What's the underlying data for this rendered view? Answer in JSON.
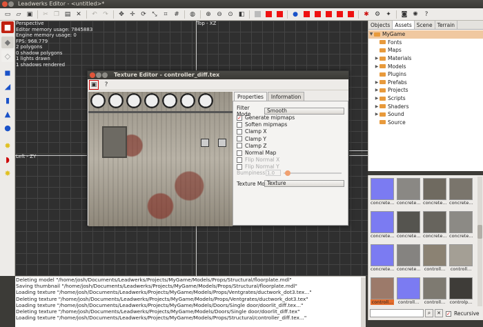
{
  "window": {
    "title": "Leadwerks Editor - <untitled>*"
  },
  "dialog": {
    "title": "Texture Editor - controller_diff.tex",
    "tabs": [
      "Properties",
      "Information"
    ],
    "filter_mode_label": "Filter Mode",
    "filter_mode_value": "Smooth",
    "options": [
      {
        "label": "Generate mipmaps",
        "checked": true,
        "enabled": true
      },
      {
        "label": "Soften mipmaps",
        "checked": false,
        "enabled": true
      },
      {
        "label": "Clamp X",
        "checked": false,
        "enabled": true
      },
      {
        "label": "Clamp Y",
        "checked": false,
        "enabled": true
      },
      {
        "label": "Clamp Z",
        "checked": false,
        "enabled": true
      },
      {
        "label": "Normal Map",
        "checked": false,
        "enabled": true
      },
      {
        "label": "Flip Normal X",
        "checked": false,
        "enabled": false
      },
      {
        "label": "Flip Normal Y",
        "checked": false,
        "enabled": false
      }
    ],
    "bumpiness_label": "Bumpiness",
    "bumpiness_value": "1.0",
    "texture_mode_label": "Texture Mo",
    "texture_mode_value": "Texture"
  },
  "viewports": {
    "perspective": {
      "lines": [
        "Perspective",
        "Editor memory usage: 7845883",
        "Engine memory usage: 0",
        "FPS: 968.779",
        "2 polygons",
        "0 shadow polygons",
        "1 lights drawn",
        "1 shadows rendered"
      ]
    },
    "top": {
      "label": "Top - XZ"
    },
    "left": {
      "label": "Left - ZY"
    }
  },
  "right_panel": {
    "tabs": [
      "Objects",
      "Assets",
      "Scene",
      "Terrain"
    ],
    "active_tab": "Assets",
    "tree": [
      {
        "label": "MyGame",
        "level": 0,
        "arrow": "▼"
      },
      {
        "label": "Fonts",
        "level": 1,
        "arrow": ""
      },
      {
        "label": "Maps",
        "level": 1,
        "arrow": ""
      },
      {
        "label": "Materials",
        "level": 1,
        "arrow": "▶"
      },
      {
        "label": "Models",
        "level": 1,
        "arrow": "▶"
      },
      {
        "label": "Plugins",
        "level": 1,
        "arrow": ""
      },
      {
        "label": "Prefabs",
        "level": 1,
        "arrow": "▶"
      },
      {
        "label": "Projects",
        "level": 1,
        "arrow": "▶"
      },
      {
        "label": "Scripts",
        "level": 1,
        "arrow": "▶"
      },
      {
        "label": "Shaders",
        "level": 1,
        "arrow": "▶"
      },
      {
        "label": "Sound",
        "level": 1,
        "arrow": "▶"
      },
      {
        "label": "Source",
        "level": 1,
        "arrow": ""
      }
    ]
  },
  "thumbnails": [
    {
      "caption": "concrete...",
      "color": "#7b7bf2"
    },
    {
      "caption": "concrete...",
      "color": "#8a8884"
    },
    {
      "caption": "concrete...",
      "color": "#6f6a60"
    },
    {
      "caption": "concrete...",
      "color": "#7a756c"
    },
    {
      "caption": "concrete...",
      "color": "#7b7bf2"
    },
    {
      "caption": "concrete...",
      "color": "#55544f"
    },
    {
      "caption": "concrete...",
      "color": "#67645d"
    },
    {
      "caption": "concrete...",
      "color": "#8c8a85"
    },
    {
      "caption": "concrete...",
      "color": "#7b7bf2"
    },
    {
      "caption": "concrete...",
      "color": "#858380"
    },
    {
      "caption": "controll...",
      "color": "#8b8273"
    },
    {
      "caption": "controll...",
      "color": "#a49f95"
    },
    {
      "caption": "controll...",
      "color": "#9c7a6a"
    },
    {
      "caption": "controll...",
      "color": "#7b7bf2"
    },
    {
      "caption": "controll...",
      "color": "#7e7a71"
    },
    {
      "caption": "controlp...",
      "color": "#3e3c38"
    }
  ],
  "search": {
    "placeholder": ""
  },
  "recursive_label": "Recursive",
  "log": [
    "Deleting model \"/home/josh/Documents/Leadwerks/Projects/MyGame/Models/Props/Structural/floorplate.mdl\"",
    "Saving thumbnail \"/home/josh/Documents/Leadwerks/Projects/MyGame/Models/Props/Structural/floorplate.mdl\"",
    "Loading texture \"/home/josh/Documents/Leadwerks/Projects/MyGame/Models/Props/Ventgrates/ductwork_dot3.tex...\"",
    "Deleting texture \"/home/josh/Documents/Leadwerks/Projects/MyGame/Models/Props/Ventgrates/ductwork_dot3.tex\"",
    "Loading texture \"/home/josh/Documents/Leadwerks/Projects/MyGame/Models/Doors/Single door/doorlit_diff.tex...\"",
    "Deleting texture \"/home/josh/Documents/Leadwerks/Projects/MyGame/Models/Doors/Single door/doorlit_diff.tex\"",
    "Loading texture \"/home/josh/Documents/Leadwerks/Projects/MyGame/Models/Props/Structural/controller_diff.tex...\""
  ],
  "colors": {
    "accent": "#e11",
    "folder": "#e89a3c",
    "viewport_bg": "#2f2f2f",
    "chrome": "#3c3b37"
  }
}
